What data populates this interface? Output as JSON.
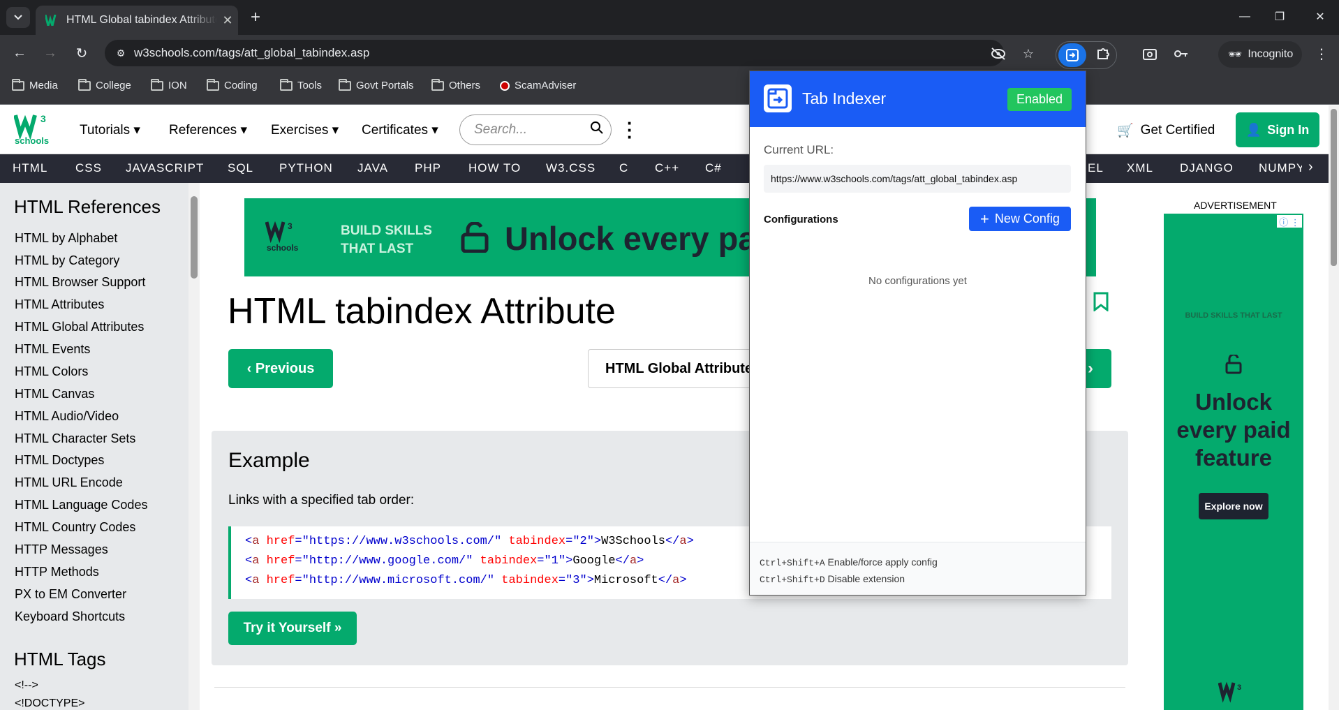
{
  "browser": {
    "tab_title": "HTML Global tabindex Attribute",
    "url": "w3schools.com/tags/att_global_tabindex.asp",
    "incognito_label": "Incognito"
  },
  "bookmarks": [
    {
      "label": "Media"
    },
    {
      "label": "College"
    },
    {
      "label": "ION"
    },
    {
      "label": "Coding"
    },
    {
      "label": "Tools"
    },
    {
      "label": "Govt Portals"
    },
    {
      "label": "Others"
    },
    {
      "label": "ScamAdviser"
    }
  ],
  "w3": {
    "logo_text": "schools",
    "nav": [
      "Tutorials",
      "References",
      "Exercises",
      "Certificates"
    ],
    "search_placeholder": "Search...",
    "get_certified": "Get Certified",
    "sign_in": "Sign In",
    "topnav": [
      "HTML",
      "CSS",
      "JAVASCRIPT",
      "SQL",
      "PYTHON",
      "JAVA",
      "PHP",
      "HOW TO",
      "W3.CSS",
      "C",
      "C++",
      "C#",
      "EL",
      "XML",
      "DJANGO",
      "NUMPY"
    ]
  },
  "leftnav": {
    "heading1": "HTML References",
    "items": [
      "HTML by Alphabet",
      "HTML by Category",
      "HTML Browser Support",
      "HTML Attributes",
      "HTML Global Attributes",
      "HTML Events",
      "HTML Colors",
      "HTML Canvas",
      "HTML Audio/Video",
      "HTML Character Sets",
      "HTML Doctypes",
      "HTML URL Encode",
      "HTML Language Codes",
      "HTML Country Codes",
      "HTTP Messages",
      "HTTP Methods",
      "PX to EM Converter",
      "Keyboard Shortcuts"
    ],
    "heading2": "HTML Tags",
    "tags": [
      "<!-->",
      "<!DOCTYPE>"
    ]
  },
  "main": {
    "banner_text": "BUILD SKILLS THAT LAST",
    "banner_headline": "Unlock every paid",
    "title": "HTML tabindex Attribute",
    "prev": "Previous",
    "ref_link": "HTML Global Attributes",
    "next": "›",
    "example_title": "Example",
    "example_desc": "Links with a specified tab order:",
    "code_lines": [
      {
        "href": "\"https://www.w3schools.com/\"",
        "tabindex": "\"2\"",
        "text": "W3Schools"
      },
      {
        "href": "\"http://www.google.com/\"",
        "tabindex": "\"1\"",
        "text": "Google"
      },
      {
        "href": "\"http://www.microsoft.com/\"",
        "tabindex": "\"3\"",
        "text": "Microsoft"
      }
    ],
    "try_it": "Try it Yourself »"
  },
  "ad": {
    "label": "ADVERTISEMENT",
    "tagline": "BUILD SKILLS THAT LAST",
    "headline": "Unlock every paid feature",
    "cta": "Explore now"
  },
  "popup": {
    "title": "Tab Indexer",
    "status": "Enabled",
    "url_label": "Current URL:",
    "url": "https://www.w3schools.com/tags/att_global_tabindex.asp",
    "configs_label": "Configurations",
    "new_config": "New Config",
    "empty": "No configurations yet",
    "shortcuts": [
      {
        "keys": "Ctrl+Shift+A",
        "desc": "Enable/force apply config"
      },
      {
        "keys": "Ctrl+Shift+D",
        "desc": "Disable extension"
      }
    ]
  },
  "colors": {
    "w3_green": "#04aa6d",
    "popup_blue": "#1a5cf5",
    "enabled_green": "#22c55e",
    "chrome_dark": "#202124"
  }
}
